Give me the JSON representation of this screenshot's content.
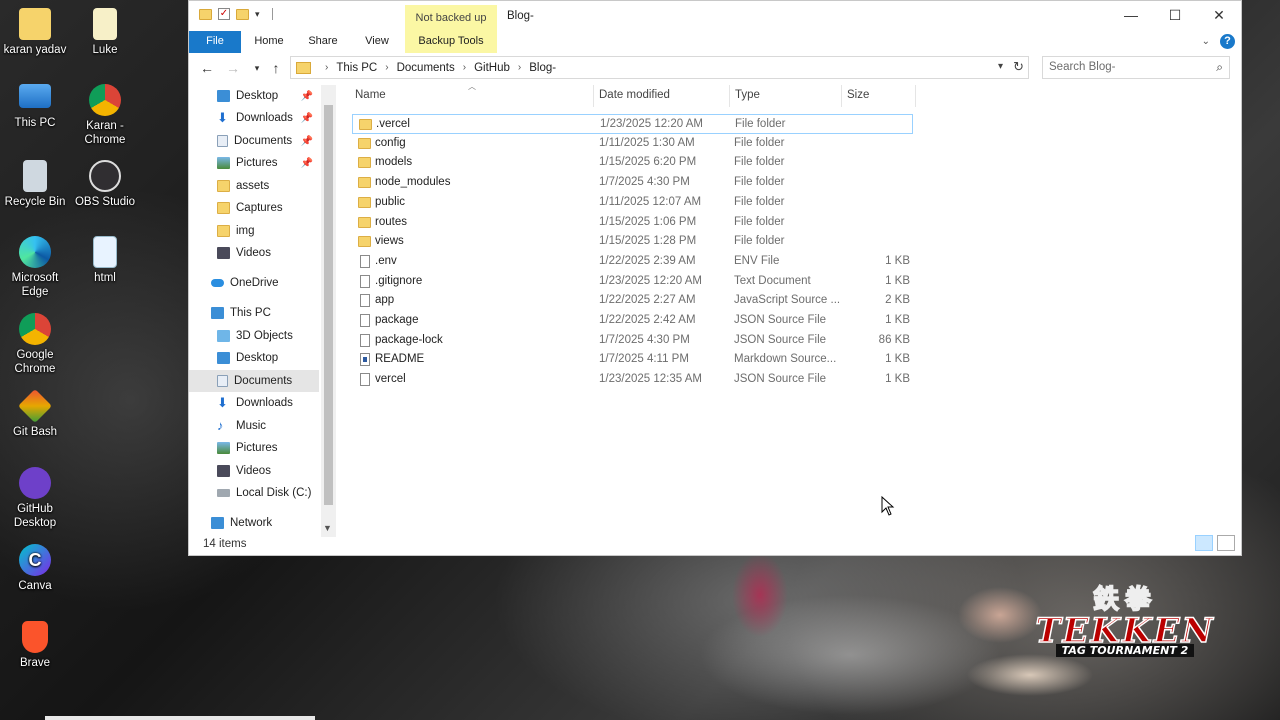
{
  "desktop": {
    "icons": [
      {
        "label": "karan yadav",
        "icon": "user-folder-icon"
      },
      {
        "label": "Luke",
        "icon": "file-icon"
      },
      {
        "label": "This PC",
        "icon": "monitor-icon"
      },
      {
        "label": "Karan - Chrome",
        "icon": "chrome-icon"
      },
      {
        "label": "Recycle Bin",
        "icon": "recycle-bin-icon"
      },
      {
        "label": "OBS Studio",
        "icon": "obs-icon"
      },
      {
        "label": "Microsoft Edge",
        "icon": "edge-icon"
      },
      {
        "label": "html",
        "icon": "html-file-icon"
      },
      {
        "label": "Google Chrome",
        "icon": "chrome-icon"
      },
      {
        "label": "Git Bash",
        "icon": "git-bash-icon"
      },
      {
        "label": "GitHub Desktop",
        "icon": "github-icon"
      },
      {
        "label": "Canva",
        "icon": "canva-icon"
      },
      {
        "label": "Brave",
        "icon": "brave-icon"
      }
    ],
    "wallpaper_logo": {
      "kanji": "鉄拳",
      "word": "TEKKEN",
      "sub": "TAG TOURNAMENT 2"
    }
  },
  "window": {
    "title": "Blog-",
    "context_tab": "Not backed up",
    "ribbon_tabs": [
      "File",
      "Home",
      "Share",
      "View",
      "Backup Tools"
    ],
    "controls": {
      "minimize": "—",
      "maximize": "☐",
      "close": "✕"
    },
    "help": "?"
  },
  "address": {
    "crumbs": [
      "This PC",
      "Documents",
      "GitHub",
      "Blog-"
    ],
    "search_placeholder": "Search Blog-"
  },
  "nav": {
    "quick_access": [
      {
        "label": "Desktop",
        "icon": "desktop-icon",
        "pinned": true
      },
      {
        "label": "Downloads",
        "icon": "download-icon",
        "pinned": true
      },
      {
        "label": "Documents",
        "icon": "documents-icon",
        "pinned": true
      },
      {
        "label": "Pictures",
        "icon": "pictures-icon",
        "pinned": true
      },
      {
        "label": "assets",
        "icon": "folder-icon",
        "pinned": false
      },
      {
        "label": "Captures",
        "icon": "folder-icon",
        "pinned": false
      },
      {
        "label": "img",
        "icon": "folder-icon",
        "pinned": false
      },
      {
        "label": "Videos",
        "icon": "videos-icon",
        "pinned": false
      }
    ],
    "onedrive": "OneDrive",
    "this_pc": "This PC",
    "this_pc_items": [
      {
        "label": "3D Objects",
        "icon": "3d-objects-icon"
      },
      {
        "label": "Desktop",
        "icon": "desktop-icon"
      },
      {
        "label": "Documents",
        "icon": "documents-icon",
        "selected": true
      },
      {
        "label": "Downloads",
        "icon": "download-icon"
      },
      {
        "label": "Music",
        "icon": "music-icon"
      },
      {
        "label": "Pictures",
        "icon": "pictures-icon"
      },
      {
        "label": "Videos",
        "icon": "videos-icon"
      },
      {
        "label": "Local Disk (C:)",
        "icon": "disk-icon"
      }
    ],
    "network": "Network"
  },
  "columns": {
    "name": "Name",
    "date": "Date modified",
    "type": "Type",
    "size": "Size"
  },
  "files": [
    {
      "name": ".vercel",
      "date": "1/23/2025 12:20 AM",
      "type": "File folder",
      "size": "",
      "kind": "folder"
    },
    {
      "name": "config",
      "date": "1/11/2025 1:30 AM",
      "type": "File folder",
      "size": "",
      "kind": "folder"
    },
    {
      "name": "models",
      "date": "1/15/2025 6:20 PM",
      "type": "File folder",
      "size": "",
      "kind": "folder"
    },
    {
      "name": "node_modules",
      "date": "1/7/2025 4:30 PM",
      "type": "File folder",
      "size": "",
      "kind": "folder"
    },
    {
      "name": "public",
      "date": "1/11/2025 12:07 AM",
      "type": "File folder",
      "size": "",
      "kind": "folder"
    },
    {
      "name": "routes",
      "date": "1/15/2025 1:06 PM",
      "type": "File folder",
      "size": "",
      "kind": "folder"
    },
    {
      "name": "views",
      "date": "1/15/2025 1:28 PM",
      "type": "File folder",
      "size": "",
      "kind": "folder"
    },
    {
      "name": ".env",
      "date": "1/22/2025 2:39 AM",
      "type": "ENV File",
      "size": "1 KB",
      "kind": "doc"
    },
    {
      "name": ".gitignore",
      "date": "1/23/2025 12:20 AM",
      "type": "Text Document",
      "size": "1 KB",
      "kind": "doc"
    },
    {
      "name": "app",
      "date": "1/22/2025 2:27 AM",
      "type": "JavaScript Source ...",
      "size": "2 KB",
      "kind": "js"
    },
    {
      "name": "package",
      "date": "1/22/2025 2:42 AM",
      "type": "JSON Source File",
      "size": "1 KB",
      "kind": "js"
    },
    {
      "name": "package-lock",
      "date": "1/7/2025 4:30 PM",
      "type": "JSON Source File",
      "size": "86 KB",
      "kind": "js"
    },
    {
      "name": "README",
      "date": "1/7/2025 4:11 PM",
      "type": "Markdown Source...",
      "size": "1 KB",
      "kind": "md"
    },
    {
      "name": "vercel",
      "date": "1/23/2025 12:35 AM",
      "type": "JSON Source File",
      "size": "1 KB",
      "kind": "js"
    }
  ],
  "status": {
    "item_count": "14 items"
  }
}
